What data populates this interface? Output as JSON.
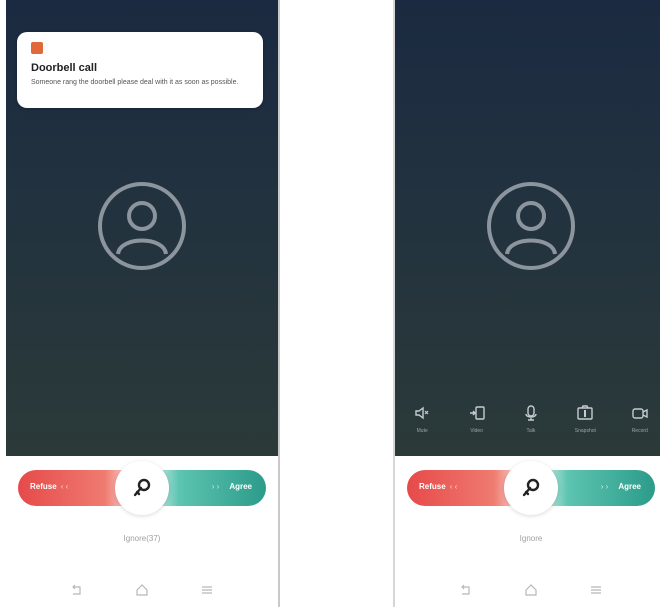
{
  "notification": {
    "title": "Doorbell call",
    "body": "Someone rang the doorbell please deal with it as soon as possible."
  },
  "left_screen": {
    "refuse_label": "Refuse",
    "refuse_arrows": "‹ ‹",
    "agree_label": "Agree",
    "agree_arrows": "› ›",
    "ignore_label": "Ignore(37)"
  },
  "right_screen": {
    "refuse_label": "Refuse",
    "refuse_arrows": "‹ ‹",
    "agree_label": "Agree",
    "agree_arrows": "› ›",
    "ignore_label": "Ignore",
    "tools": [
      {
        "icon": "speaker-icon",
        "label": "Mute"
      },
      {
        "icon": "screen-cast-icon",
        "label": "Video"
      },
      {
        "icon": "microphone-icon",
        "label": "Talk"
      },
      {
        "icon": "snapshot-icon",
        "label": "Snapshot"
      },
      {
        "icon": "record-video-icon",
        "label": "Record"
      }
    ]
  },
  "colors": {
    "refuse": "#e64a4a",
    "agree": "#2c9b8a",
    "call_background": "#1b2a40",
    "notification_icon": "#e0683a"
  }
}
